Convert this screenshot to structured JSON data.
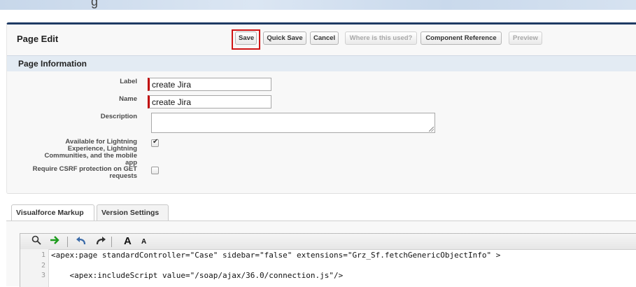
{
  "header": {
    "partial_title": "g"
  },
  "page_edit": {
    "title": "Page Edit",
    "buttons": {
      "save": "Save",
      "quick_save": "Quick Save",
      "cancel": "Cancel",
      "where_used": "Where is this used?",
      "component_reference": "Component Reference",
      "preview": "Preview"
    }
  },
  "page_information": {
    "title": "Page Information",
    "label_label": "Label",
    "label_value": "create Jira",
    "name_label": "Name",
    "name_value": "create Jira",
    "description_label": "Description",
    "description_value": "",
    "lightning_label": "Available for Lightning Experience, Lightning Communities, and the mobile app",
    "lightning_checked": true,
    "csrf_label": "Require CSRF protection on GET requests",
    "csrf_checked": false
  },
  "tabs": {
    "markup": "Visualforce Markup",
    "version": "Version Settings"
  },
  "editor": {
    "icons": [
      "search-icon",
      "goto-arrow-icon",
      "undo-icon",
      "redo-icon",
      "font-increase-icon",
      "font-decrease-icon"
    ],
    "font_large": "A",
    "font_small": "A",
    "line_numbers": [
      "1",
      "2",
      "3"
    ],
    "lines": [
      "<apex:page standardController=\"Case\" sidebar=\"false\" extensions=\"Grz_Sf.fetchGenericObjectInfo\" >",
      "",
      "    <apex:includeScript value=\"/soap/ajax/36.0/connection.js\"/>"
    ]
  },
  "colors": {
    "accent_dark": "#1f3b64",
    "required": "#c00000",
    "highlight": "#d01515",
    "section_bg": "#e3ebf3"
  }
}
